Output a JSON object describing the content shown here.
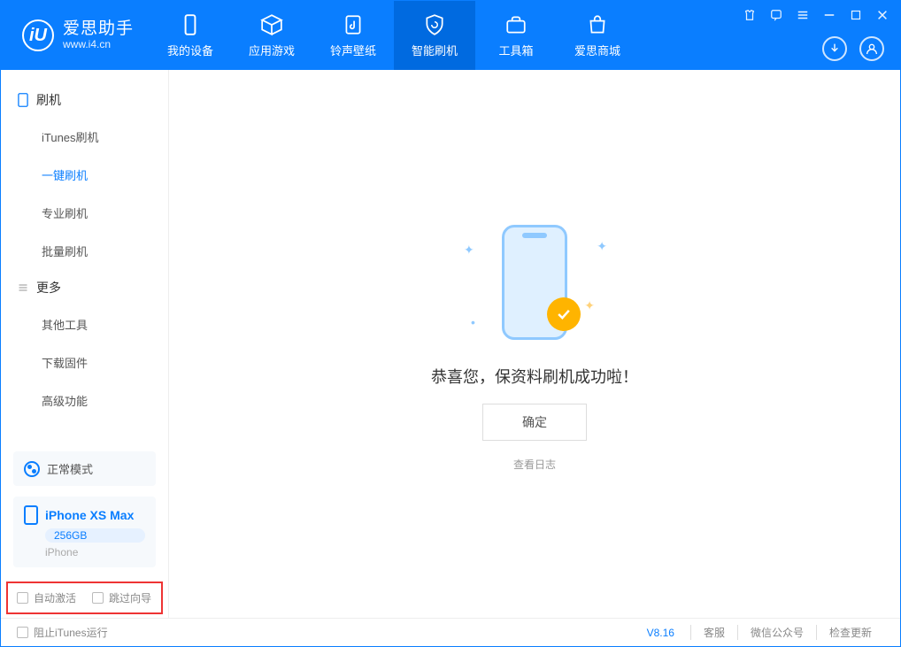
{
  "app": {
    "name_zh": "爱思助手",
    "name_en": "www.i4.cn"
  },
  "nav": {
    "items": [
      {
        "label": "我的设备"
      },
      {
        "label": "应用游戏"
      },
      {
        "label": "铃声壁纸"
      },
      {
        "label": "智能刷机"
      },
      {
        "label": "工具箱"
      },
      {
        "label": "爱思商城"
      }
    ]
  },
  "sidebar": {
    "section1_title": "刷机",
    "section1_items": [
      {
        "label": "iTunes刷机"
      },
      {
        "label": "一键刷机"
      },
      {
        "label": "专业刷机"
      },
      {
        "label": "批量刷机"
      }
    ],
    "section2_title": "更多",
    "section2_items": [
      {
        "label": "其他工具"
      },
      {
        "label": "下载固件"
      },
      {
        "label": "高级功能"
      }
    ],
    "mode_label": "正常模式",
    "device": {
      "name": "iPhone XS Max",
      "capacity": "256GB",
      "type": "iPhone"
    },
    "check1": "自动激活",
    "check2": "跳过向导"
  },
  "main": {
    "success_text": "恭喜您，保资料刷机成功啦！",
    "ok_label": "确定",
    "view_log": "查看日志"
  },
  "footer": {
    "block_itunes": "阻止iTunes运行",
    "version": "V8.16",
    "links": [
      "客服",
      "微信公众号",
      "检查更新"
    ]
  }
}
